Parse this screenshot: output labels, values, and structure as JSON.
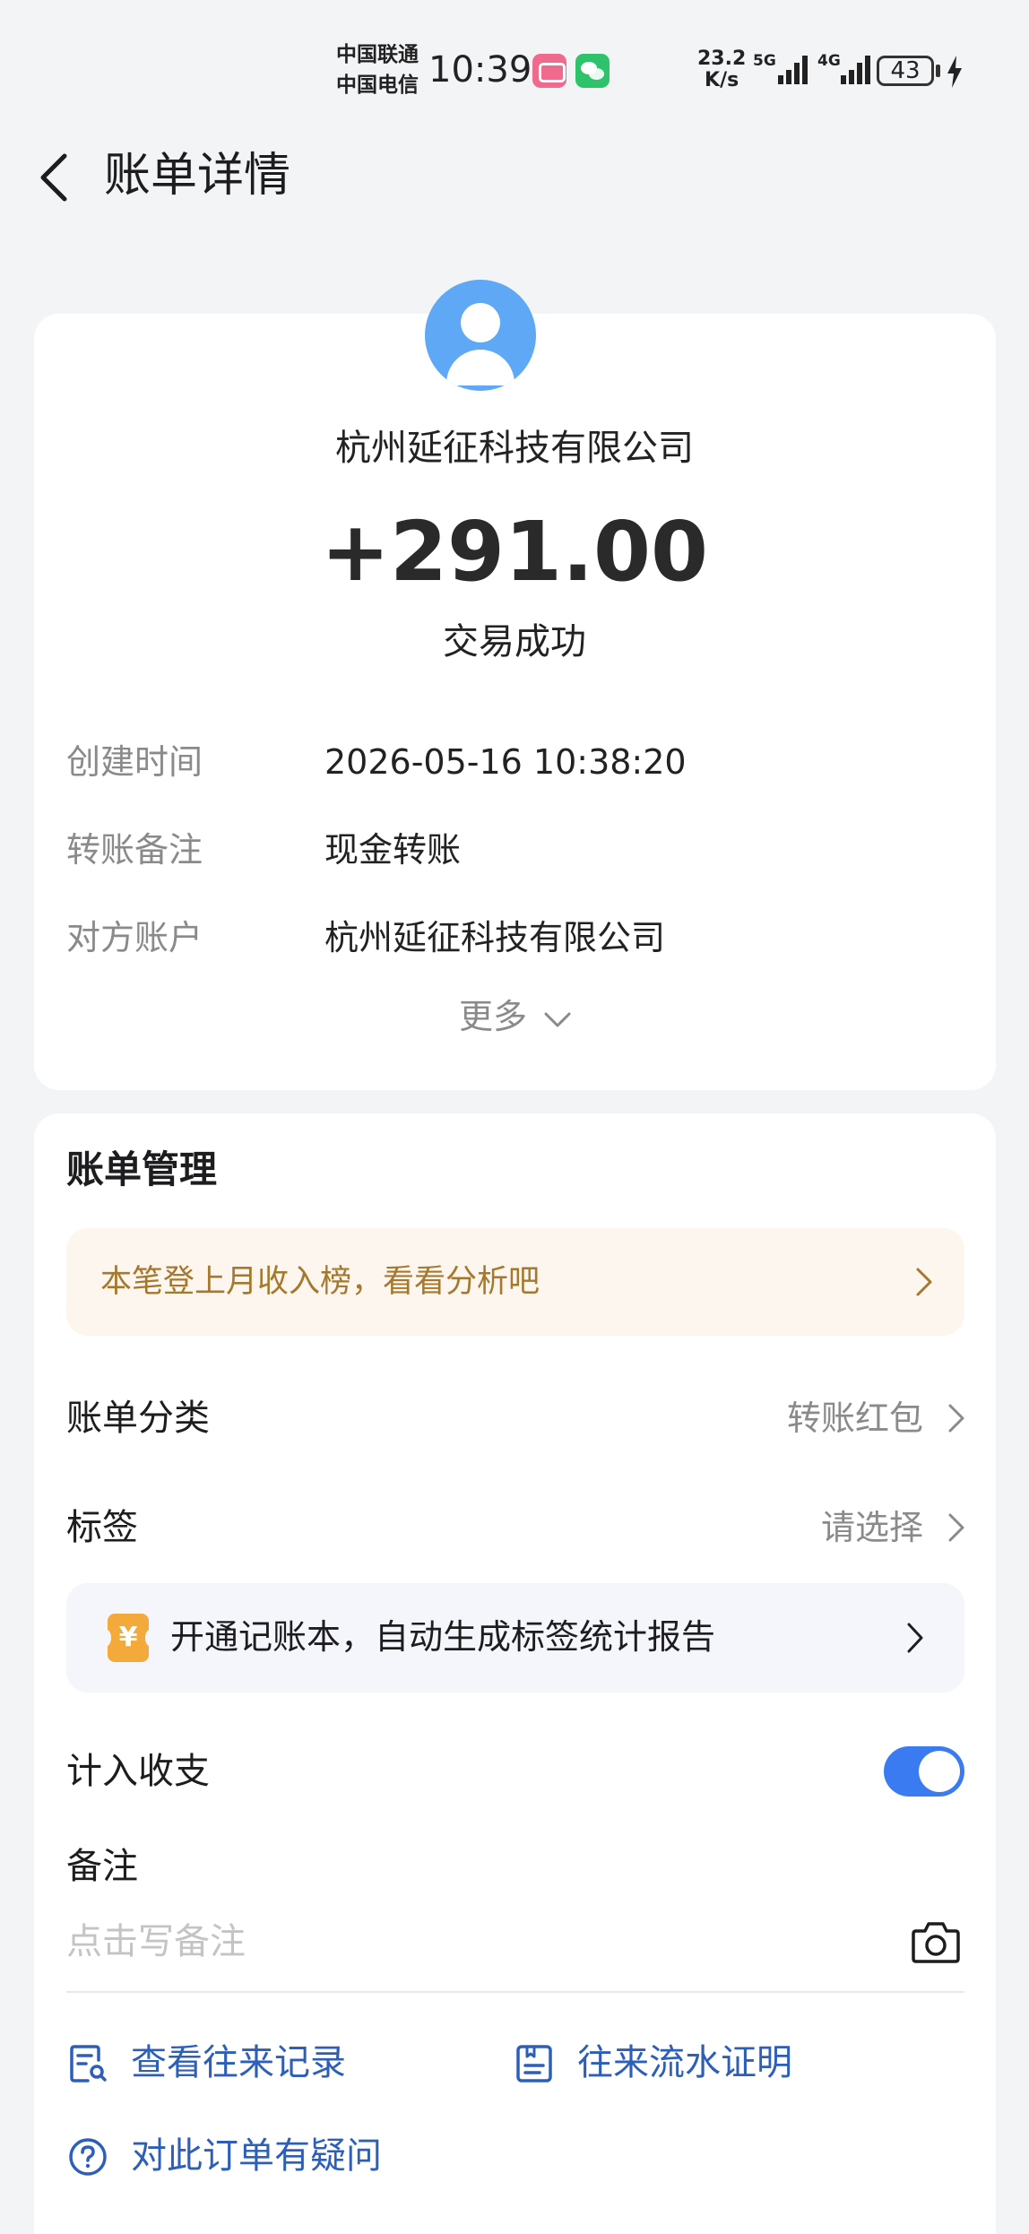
{
  "status_bar": {
    "carrier_1": "中国联通",
    "carrier_2": "中国电信",
    "time": "10:39",
    "speed_value": "23.2",
    "speed_unit": "K/s",
    "sim1_network": "5G",
    "sim2_network": "4G",
    "battery": "43"
  },
  "header": {
    "title": "账单详情"
  },
  "transaction": {
    "merchant": "杭州延征科技有限公司",
    "amount": "+291.00",
    "status": "交易成功",
    "details": [
      {
        "label": "创建时间",
        "value": "2026-05-16 10:38:20"
      },
      {
        "label": "转账备注",
        "value": "现金转账"
      },
      {
        "label": "对方账户",
        "value": "杭州延征科技有限公司"
      }
    ],
    "more_label": "更多"
  },
  "management": {
    "title": "账单管理",
    "promo_text": "本笔登上月收入榜，看看分析吧",
    "category_label": "账单分类",
    "category_value": "转账红包",
    "tag_label": "标签",
    "tag_value": "请选择",
    "ledger_icon_text": "¥",
    "ledger_text": "开通记账本，自动生成标签统计报告",
    "include_label": "计入收支",
    "include_on": true,
    "note_label": "备注",
    "note_placeholder": "点击写备注"
  },
  "actions": {
    "records": "查看往来记录",
    "proof": "往来流水证明",
    "question": "对此订单有疑问"
  },
  "colors": {
    "accent": "#3a7bf2",
    "link": "#2d5fb9",
    "promo_text": "#a5782e",
    "avatar": "#5fa8f5",
    "ledger_icon": "#f4a93b"
  },
  "icons": {
    "back": "chevron-left-icon",
    "more": "chevron-down-icon",
    "arrow": "chevron-right-icon",
    "camera": "camera-icon",
    "records": "records-search-icon",
    "proof": "document-icon",
    "question": "question-circle-icon"
  }
}
